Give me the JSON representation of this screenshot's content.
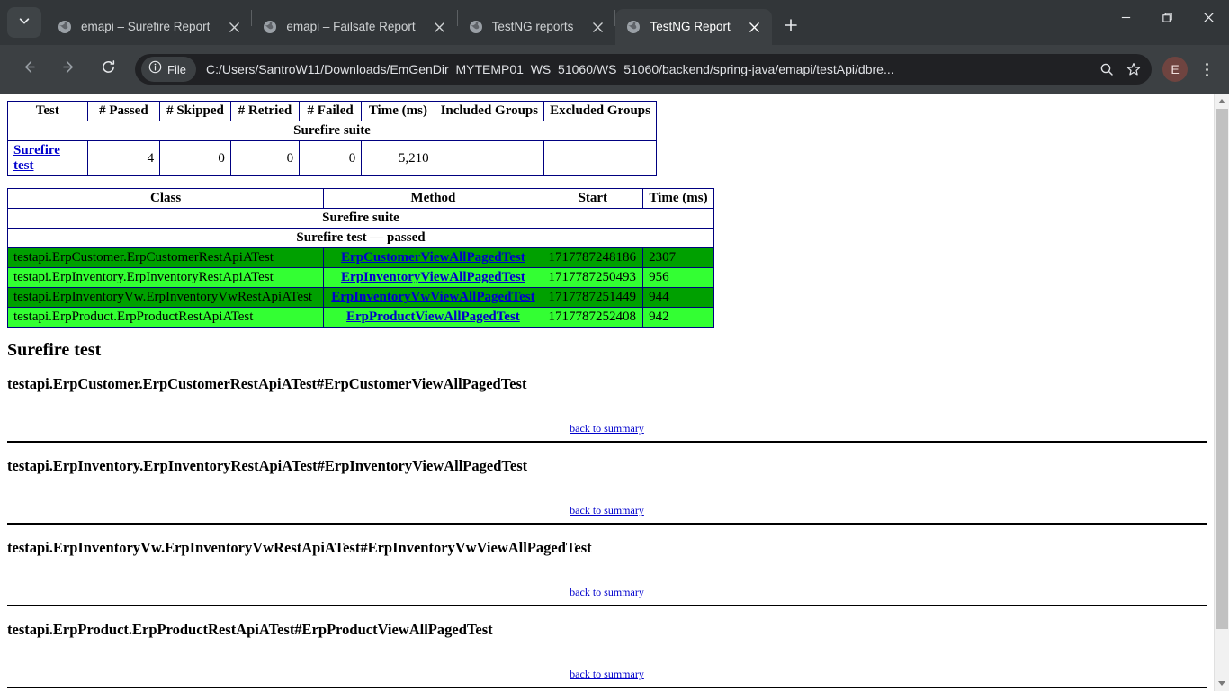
{
  "browser": {
    "tabs": [
      {
        "title": "emapi – Surefire Report",
        "active": false,
        "icon": "globe-icon"
      },
      {
        "title": "emapi – Failsafe Report",
        "active": false,
        "icon": "globe-icon"
      },
      {
        "title": "TestNG reports",
        "active": false,
        "icon": "globe-icon"
      },
      {
        "title": "TestNG Report",
        "active": true,
        "icon": "globe-icon"
      }
    ],
    "toolbar": {
      "back": "back-icon",
      "forward": "forward-icon",
      "reload": "reload-icon",
      "file_chip_label": "File",
      "url": "C:/Users/SantroW11/Downloads/EmGenDir_MYTEMP01_WS_51060/WS_51060/backend/spring-java/emapi/testApi/dbre...",
      "zoom_icon": "search-zoom-icon",
      "bookmark_icon": "star-icon",
      "avatar_initial": "E",
      "menu_icon": "kebab-menu-icon"
    },
    "window_controls": {
      "minimize": "minimize-icon",
      "maximize": "restore-icon",
      "close": "close-icon"
    },
    "new_tab_label": "+",
    "tab_list_icon": "chevron-down-icon"
  },
  "report": {
    "summary_table": {
      "headers": [
        "Test",
        "# Passed",
        "# Skipped",
        "# Retried",
        "# Failed",
        "Time (ms)",
        "Included Groups",
        "Excluded Groups"
      ],
      "suite_row": "Surefire suite",
      "rows": [
        {
          "test": "Surefire test",
          "passed": "4",
          "skipped": "0",
          "retried": "0",
          "failed": "0",
          "time": "5,210",
          "included": "",
          "excluded": ""
        }
      ]
    },
    "methods_table": {
      "headers": [
        "Class",
        "Method",
        "Start",
        "Time (ms)"
      ],
      "suite_row": "Surefire suite",
      "test_row": "Surefire test — passed",
      "rows": [
        {
          "class": "testapi.ErpCustomer.ErpCustomerRestApiATest",
          "method": "ErpCustomerViewAllPagedTest",
          "start": "1717787248186",
          "time": "2307",
          "shade": "dark"
        },
        {
          "class": "testapi.ErpInventory.ErpInventoryRestApiATest",
          "method": "ErpInventoryViewAllPagedTest",
          "start": "1717787250493",
          "time": "956",
          "shade": "light"
        },
        {
          "class": "testapi.ErpInventoryVw.ErpInventoryVwRestApiATest",
          "method": "ErpInventoryVwViewAllPagedTest",
          "start": "1717787251449",
          "time": "944",
          "shade": "dark"
        },
        {
          "class": "testapi.ErpProduct.ErpProductRestApiATest",
          "method": "ErpProductViewAllPagedTest",
          "start": "1717787252408",
          "time": "942",
          "shade": "light"
        }
      ]
    },
    "section_title": "Surefire test",
    "back_link_label": "back to summary",
    "details": [
      {
        "name": "testapi.ErpCustomer.ErpCustomerRestApiATest#ErpCustomerViewAllPagedTest"
      },
      {
        "name": "testapi.ErpInventory.ErpInventoryRestApiATest#ErpInventoryViewAllPagedTest"
      },
      {
        "name": "testapi.ErpInventoryVw.ErpInventoryVwRestApiATest#ErpInventoryVwViewAllPagedTest"
      },
      {
        "name": "testapi.ErpProduct.ErpProductRestApiATest#ErpProductViewAllPagedTest"
      }
    ]
  },
  "colors": {
    "chrome_bg": "#323639",
    "toolbar_bg": "#3c4043",
    "omnibox_bg": "#202124",
    "table_border": "#000080",
    "link": "#0000cc",
    "row_dark_green": "#00a000",
    "row_light_green": "#33ff33",
    "avatar_bg": "#6f4440"
  }
}
